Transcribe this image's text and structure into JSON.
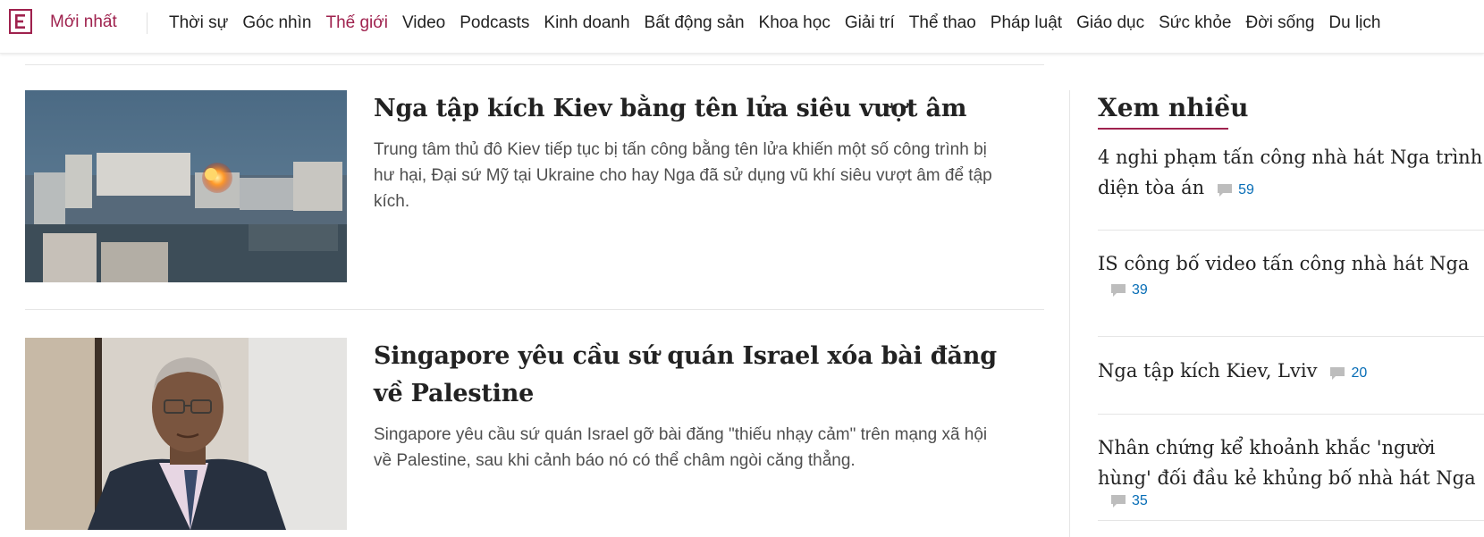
{
  "nav": {
    "latest_label": "Mới nhất",
    "items": [
      {
        "label": "Thời sự",
        "active": false
      },
      {
        "label": "Góc nhìn",
        "active": false
      },
      {
        "label": "Thế giới",
        "active": true
      },
      {
        "label": "Video",
        "active": false
      },
      {
        "label": "Podcasts",
        "active": false
      },
      {
        "label": "Kinh doanh",
        "active": false
      },
      {
        "label": "Bất động sản",
        "active": false
      },
      {
        "label": "Khoa học",
        "active": false
      },
      {
        "label": "Giải trí",
        "active": false
      },
      {
        "label": "Thể thao",
        "active": false
      },
      {
        "label": "Pháp luật",
        "active": false
      },
      {
        "label": "Giáo dục",
        "active": false
      },
      {
        "label": "Sức khỏe",
        "active": false
      },
      {
        "label": "Đời sống",
        "active": false
      },
      {
        "label": "Du lịch",
        "active": false
      }
    ]
  },
  "articles": [
    {
      "title": "Nga tập kích Kiev bằng tên lửa siêu vượt âm",
      "description": "Trung tâm thủ đô Kiev tiếp tục bị tấn công bằng tên lửa khiến một số công trình bị hư hại, Đại sứ Mỹ tại Ukraine cho hay Nga đã sử dụng vũ khí siêu vượt âm để tập kích.",
      "thumbnail": "explosion-over-kiev-skyline"
    },
    {
      "title": "Singapore yêu cầu sứ quán Israel xóa bài đăng về Palestine",
      "description": "Singapore yêu cầu sứ quán Israel gỡ bài đăng \"thiếu nhạy cảm\" trên mạng xã hội về Palestine, sau khi cảnh báo nó có thể châm ngòi căng thẳng.",
      "thumbnail": "man-in-suit-portrait"
    }
  ],
  "sidebar": {
    "heading": "Xem nhiều",
    "items": [
      {
        "title": "4 nghi phạm tấn công nhà hát Nga trình diện tòa án",
        "comments": "59"
      },
      {
        "title": "IS công bố video tấn công nhà hát Nga",
        "comments": "39"
      },
      {
        "title": "Nga tập kích Kiev, Lviv",
        "comments": "20"
      },
      {
        "title": "Nhân chứng kể khoảnh khắc 'người hùng' đối đầu kẻ khủng bố nhà hát Nga",
        "comments": "35"
      }
    ]
  },
  "colors": {
    "brand": "#9f224e",
    "link_blue": "#076db6",
    "text": "#222222",
    "description": "#4f4f4f"
  },
  "icons": [
    "vnexpress-logo-icon",
    "comment-icon"
  ]
}
